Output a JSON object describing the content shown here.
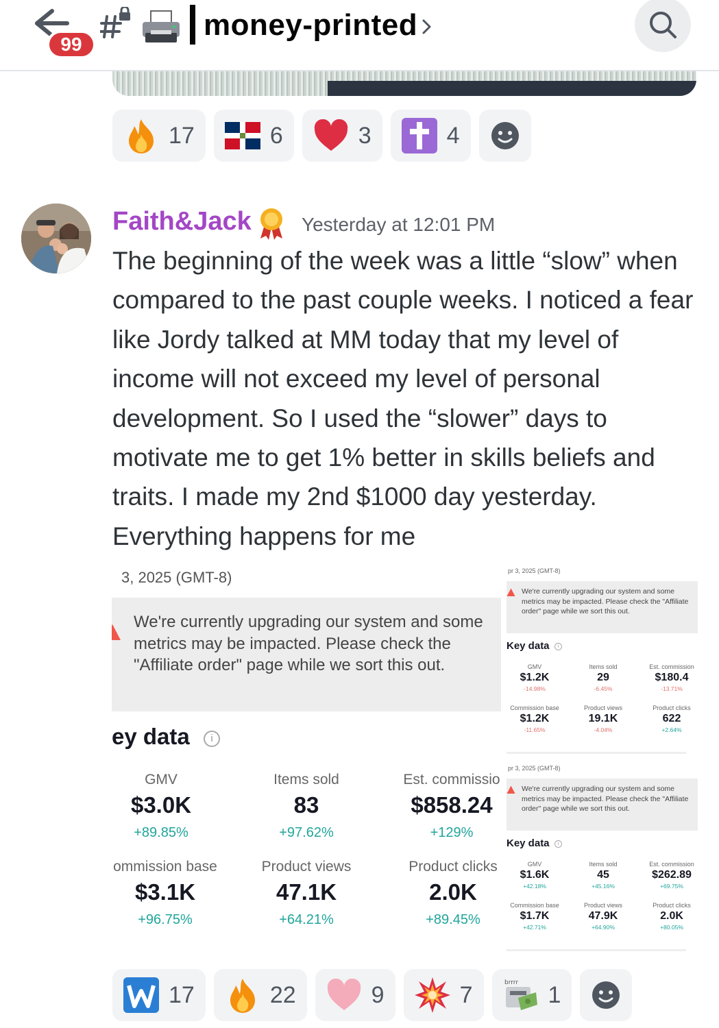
{
  "header": {
    "unread_badge": "99",
    "channel_name": "money-printed"
  },
  "reactions_top": [
    {
      "emoji": "fire",
      "count": "17"
    },
    {
      "emoji": "dominican-flag",
      "count": "6"
    },
    {
      "emoji": "red-heart",
      "count": "3"
    },
    {
      "emoji": "latin-cross",
      "count": "4"
    }
  ],
  "message": {
    "author": "Faith&Jack",
    "timestamp": "Yesterday at 12:01 PM",
    "text": "The beginning of the week was a little “slow” when compared to the past couple weeks. I noticed a fear like Jordy talked at MM today that my level of income will not exceed my level of personal development. So I used the “slower” days to motivate me to get 1% better in skills beliefs and traits. I made my 2nd $1000 day yesterday. Everything happens for me"
  },
  "screenshot_main": {
    "date": "3, 2025 (GMT-8)",
    "alert": "We're currently upgrading our system and some metrics may be impacted. Please check the \"Affiliate order\" page while we sort this out.",
    "key_data_title": "ey data",
    "metrics": [
      {
        "label": "GMV",
        "value": "$3.0K",
        "change": "+89.85%"
      },
      {
        "label": "Items sold",
        "value": "83",
        "change": "+97.62%"
      },
      {
        "label": "Est. commissio",
        "value": "$858.24",
        "change": "+129%"
      },
      {
        "label": "ommission base",
        "value": "$3.1K",
        "change": "+96.75%"
      },
      {
        "label": "Product views",
        "value": "47.1K",
        "change": "+64.21%"
      },
      {
        "label": "Product clicks",
        "value": "2.0K",
        "change": "+89.45%"
      }
    ]
  },
  "screenshot_a": {
    "date": "pr 3, 2025 (GMT-8)",
    "alert": "We're currently upgrading our system and some metrics may be impacted. Please check the \"Affiliate order\" page while we sort this out.",
    "key_data_title": "Key data",
    "metrics": [
      {
        "label": "GMV",
        "value": "$1.2K",
        "change": "-14.98%"
      },
      {
        "label": "Items sold",
        "value": "29",
        "change": "-6.45%"
      },
      {
        "label": "Est. commission",
        "value": "$180.4",
        "change": "-13.71%"
      },
      {
        "label": "Commission base",
        "value": "$1.2K",
        "change": "-11.65%"
      },
      {
        "label": "Product views",
        "value": "19.1K",
        "change": "-4.04%"
      },
      {
        "label": "Product clicks",
        "value": "622",
        "change": "+2.64%"
      }
    ]
  },
  "screenshot_b": {
    "date": "pr 3, 2025 (GMT-8)",
    "alert": "We're currently upgrading our system and some metrics may be impacted. Please check the \"Affiliate order\" page while we sort this out.",
    "key_data_title": "Key data",
    "metrics": [
      {
        "label": "GMV",
        "value": "$1.6K",
        "change": "+42.18%"
      },
      {
        "label": "Items sold",
        "value": "45",
        "change": "+45.16%"
      },
      {
        "label": "Est. commission",
        "value": "$262.89",
        "change": "+69.75%"
      },
      {
        "label": "Commission base",
        "value": "$1.7K",
        "change": "+42.71%"
      },
      {
        "label": "Product views",
        "value": "47.9K",
        "change": "+64.90%"
      },
      {
        "label": "Product clicks",
        "value": "2.0K",
        "change": "+80.05%"
      }
    ]
  },
  "reactions_bottom": [
    {
      "emoji": "letter-w",
      "count": "17"
    },
    {
      "emoji": "fire",
      "count": "22"
    },
    {
      "emoji": "pink-heart",
      "count": "9"
    },
    {
      "emoji": "explosion",
      "count": "7"
    },
    {
      "emoji": "money-printer",
      "count": "1"
    }
  ],
  "colors": {
    "author": "#a347c6",
    "badge": "#da373c",
    "positive": "#20a59b",
    "negative": "#e2706c"
  }
}
